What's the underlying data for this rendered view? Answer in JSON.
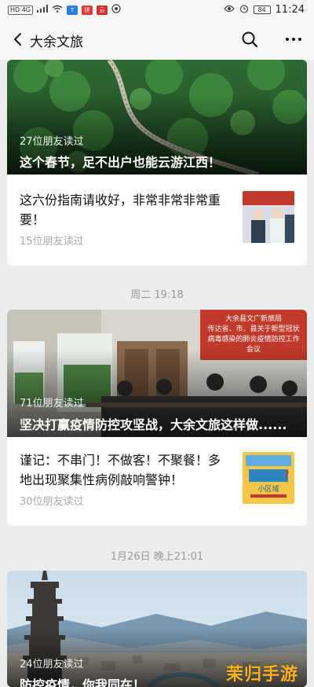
{
  "status_bar": {
    "network": "HD 4G",
    "app_badges": [
      "T",
      "拼",
      "云"
    ],
    "battery": "84",
    "time": "11:24"
  },
  "nav": {
    "back_icon": "chevron-left-icon",
    "title": "大余文旅",
    "search_icon": "search-icon",
    "more_icon": "more-dots-icon"
  },
  "groups": [
    {
      "timestamp": "",
      "hero": {
        "readers": "27位朋友读过",
        "title": "这个春节，足不出户也能云游江西！"
      },
      "items": [
        {
          "title": "这六份指南请收好，非常非常非常重要！",
          "readers": "15位朋友读过"
        }
      ]
    },
    {
      "timestamp": "周二 19:18",
      "hero": {
        "readers": "71位朋友读过",
        "title": "坚决打赢疫情防控攻坚战，大余文旅这样做......",
        "banner_text": "大余县文广新旅局 传达省、市、县关于新型冠状 病毒感染的肺炎疫情防控工作 会议"
      },
      "items": [
        {
          "title": "谨记：不串门！不做客！不聚餐！多地出现聚集性病例敲响警钟！",
          "readers": "30位朋友读过"
        }
      ]
    },
    {
      "timestamp": "1月26日 晚上21:01",
      "hero": {
        "readers": "24位朋友读过",
        "title": "防控疫情，你我同在！"
      },
      "items": []
    }
  ],
  "watermark": "茉归手游网",
  "colors": {
    "background": "#ededed",
    "card": "#ffffff",
    "secondary_text": "#aaaaaa",
    "timestamp": "#999999"
  }
}
